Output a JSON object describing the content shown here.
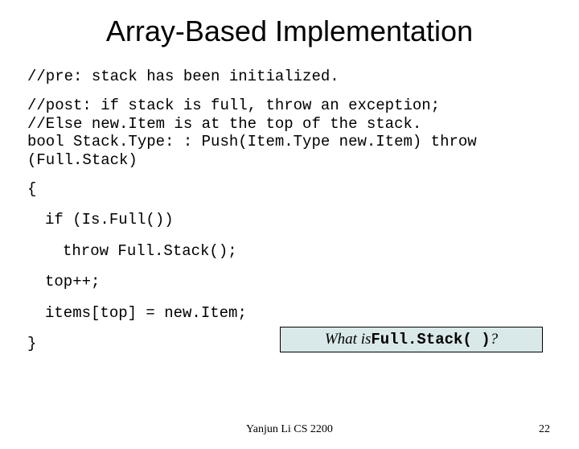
{
  "title": "Array-Based Implementation",
  "code": {
    "pre": "//pre: stack has been initialized.",
    "post1": "//post: if stack is full, throw an exception;",
    "post2": "//Else new.Item is at the top of the stack.",
    "sig1": "bool Stack.Type: : Push(Item.Type new.Item) throw",
    "sig2": "(Full.Stack)",
    "open": "{",
    "ifline": "if (Is.Full())",
    "throwline": "throw Full.Stack();",
    "incr": "top++;",
    "assign": "items[top] = new.Item;",
    "close": "}"
  },
  "callout": {
    "prefix": "What is ",
    "mono": "Full.Stack( )",
    "suffix": " ?"
  },
  "footer": {
    "center": "Yanjun Li CS 2200",
    "page": "22"
  }
}
